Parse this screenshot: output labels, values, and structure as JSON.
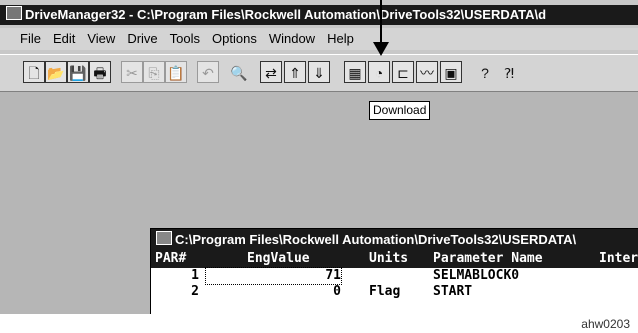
{
  "window": {
    "title": "DriveManager32 - C:\\Program Files\\Rockwell Automation\\DriveTools32\\USERDATA\\d"
  },
  "menu": [
    "File",
    "Edit",
    "View",
    "Drive",
    "Tools",
    "Options",
    "Window",
    "Help"
  ],
  "toolbar": [
    {
      "name": "new-icon",
      "glyph": "🗋"
    },
    {
      "name": "open-icon",
      "glyph": "📂"
    },
    {
      "name": "save-icon",
      "glyph": "💾"
    },
    {
      "name": "print-icon",
      "glyph": "🖶"
    },
    {
      "name": "cut-icon",
      "glyph": "✂",
      "dim": true
    },
    {
      "name": "copy-icon",
      "glyph": "⎘",
      "dim": true
    },
    {
      "name": "paste-icon",
      "glyph": "📋",
      "dim": true
    },
    {
      "name": "undo-icon",
      "glyph": "↶",
      "dim": true
    },
    {
      "name": "find-icon",
      "glyph": "🔍",
      "plain": true
    },
    {
      "name": "connect-icon",
      "glyph": "⇄"
    },
    {
      "name": "upload-icon",
      "glyph": "⇑"
    },
    {
      "name": "download-icon",
      "glyph": "⇓"
    },
    {
      "name": "monitor-icon",
      "glyph": "▦"
    },
    {
      "name": "gauge-icon",
      "glyph": "◔"
    },
    {
      "name": "block-icon",
      "glyph": "⊏"
    },
    {
      "name": "trend-icon",
      "glyph": "〰"
    },
    {
      "name": "calculator-icon",
      "glyph": "▣"
    },
    {
      "name": "help-icon",
      "glyph": "?",
      "plain": true
    },
    {
      "name": "context-help-icon",
      "glyph": "⁈",
      "plain": true
    }
  ],
  "tooltip": "Download",
  "child": {
    "title": "C:\\Program Files\\Rockwell Automation\\DriveTools32\\USERDATA\\",
    "headers": [
      "PAR#",
      "EngValue",
      "Units",
      "Parameter Name",
      "Inter"
    ],
    "rows": [
      {
        "par": "1",
        "value": "71",
        "units": "",
        "name": "SELMABLOCK0"
      },
      {
        "par": "2",
        "value": "0",
        "units": "Flag",
        "name": "START"
      }
    ]
  },
  "caption": "ahw0203"
}
